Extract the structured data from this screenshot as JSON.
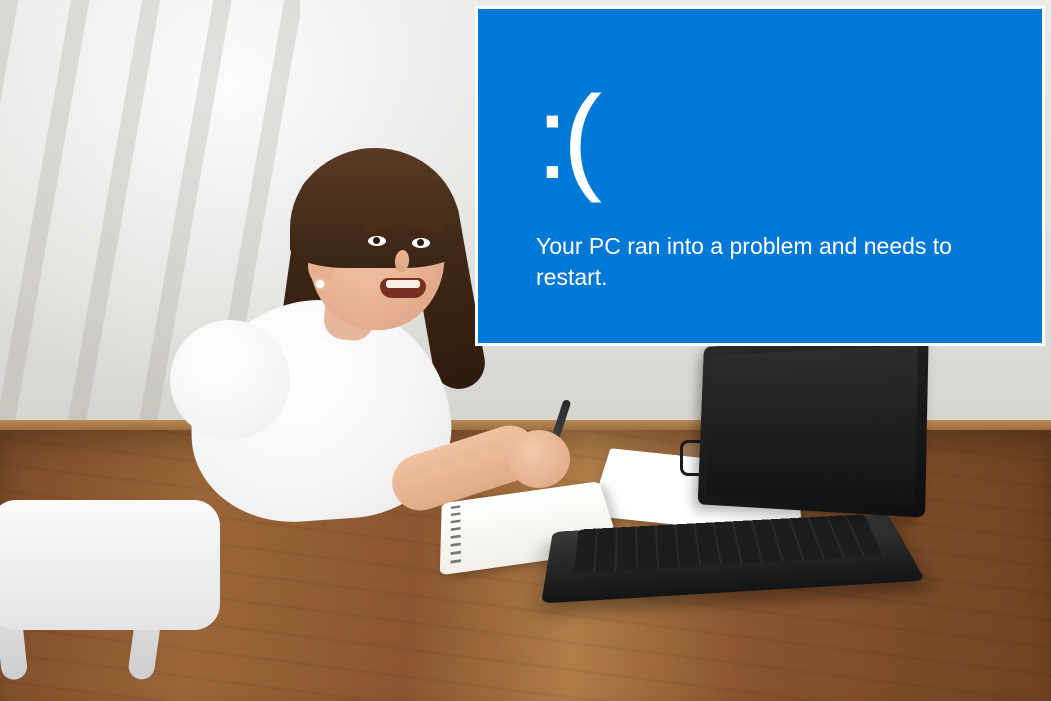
{
  "bsod": {
    "emoticon": ":(",
    "message": "Your PC ran into a problem and needs to restart."
  },
  "scene": {
    "description": "Frustrated young woman at wooden desk with laptop, notebook, pen, glasses; BSOD inset top-right",
    "overlay_border_color": "#ffffff",
    "overlay_bg_color": "#0078d7"
  }
}
